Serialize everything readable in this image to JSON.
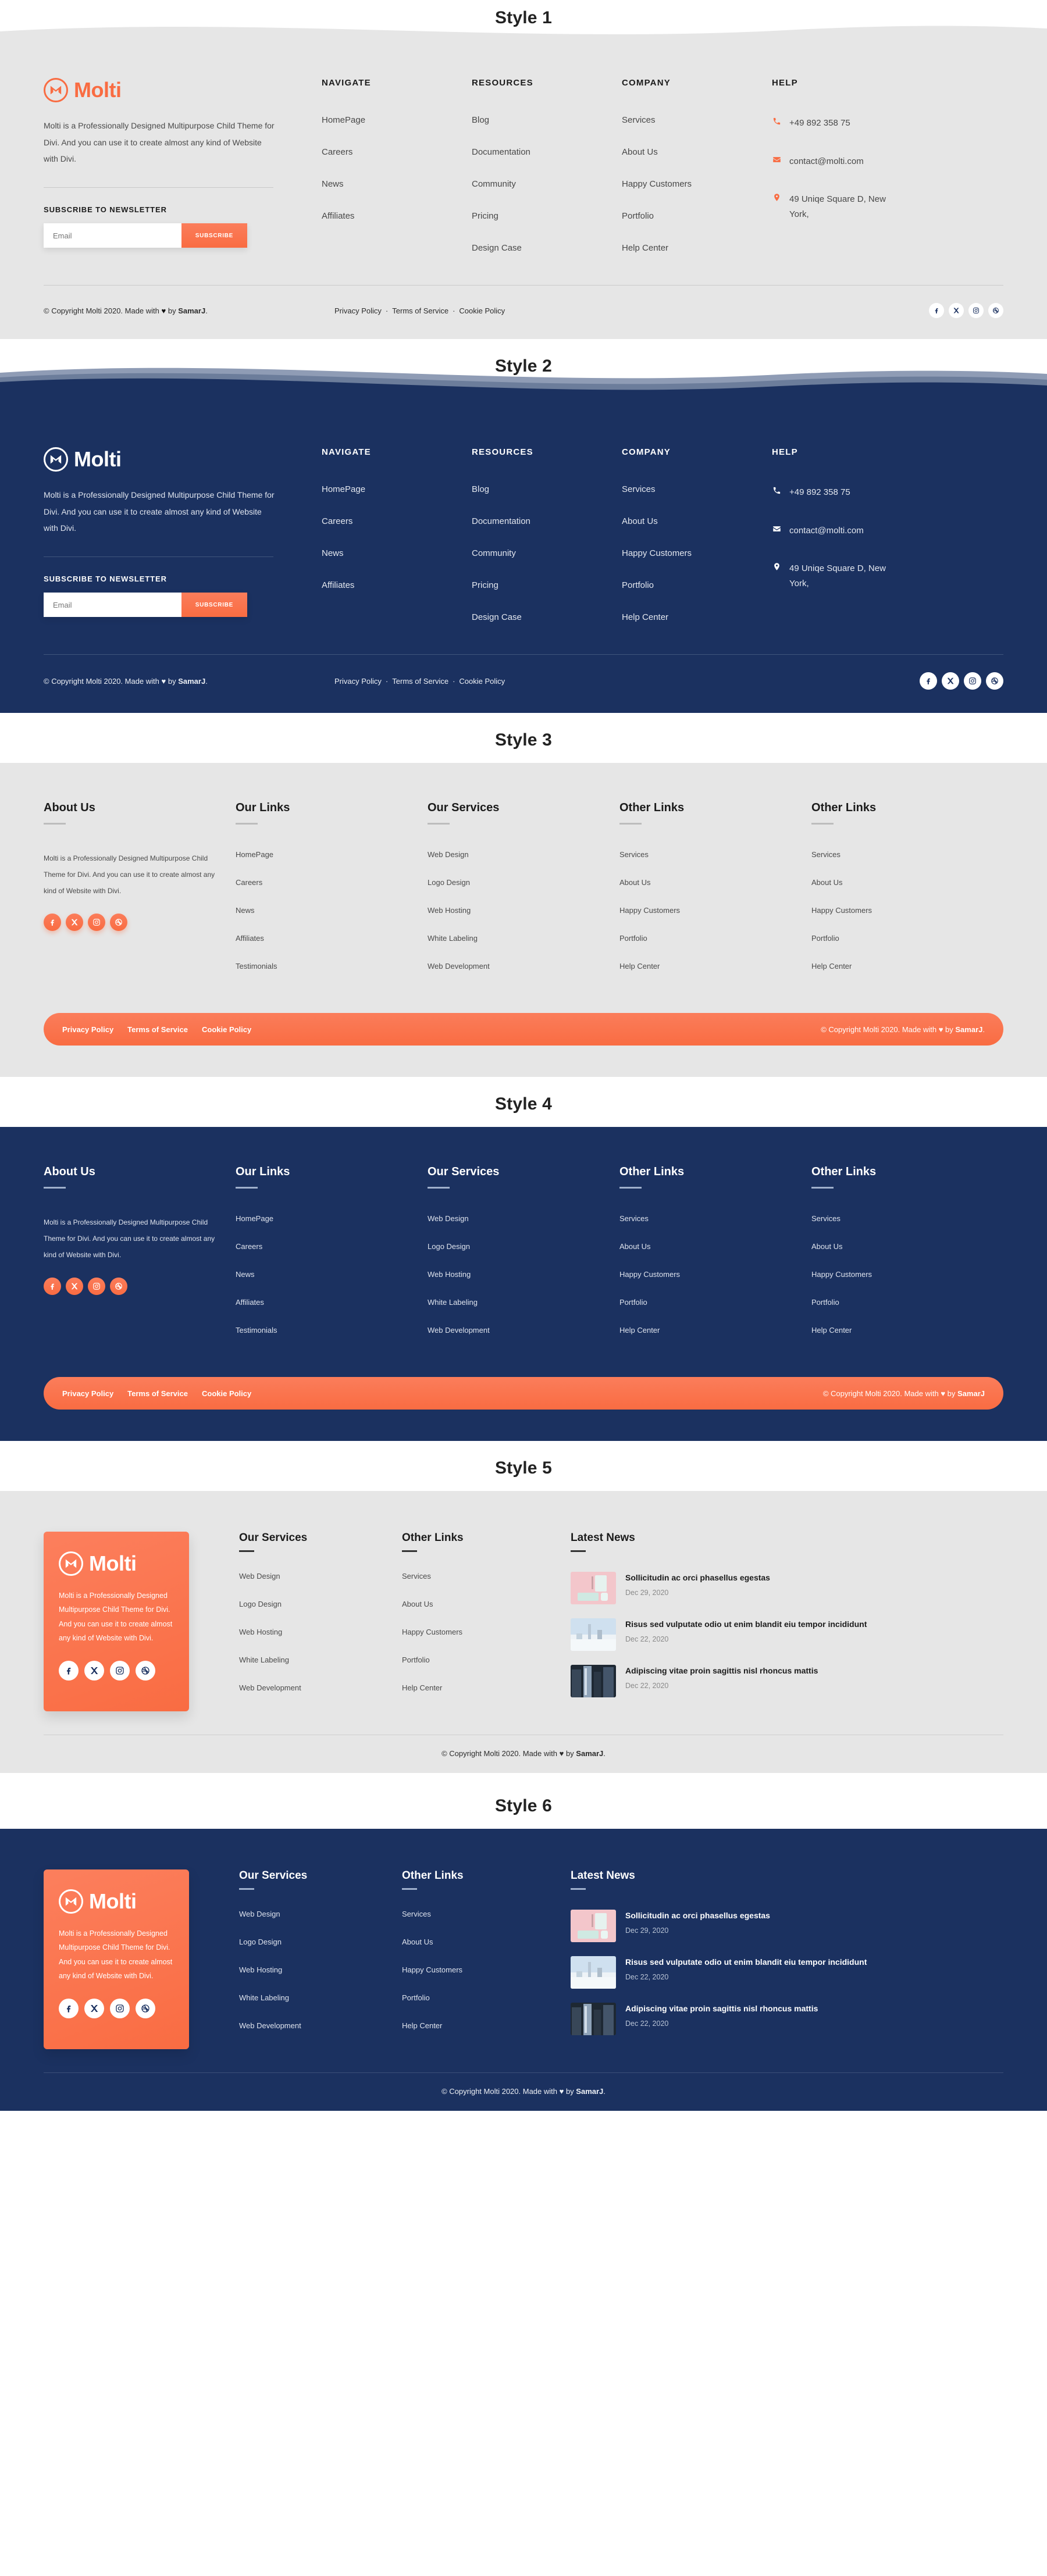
{
  "brand": {
    "name": "Molti",
    "colors": {
      "orange": "#F96C42",
      "navy": "#1B3160",
      "light_gray_bg": "#E6E6E6",
      "white": "#FFFFFF"
    }
  },
  "section_titles": {
    "s1": "Style 1",
    "s2": "Style 2",
    "s3": "Style 3",
    "s4": "Style 4",
    "s5": "Style 5",
    "s6": "Style 6"
  },
  "about": {
    "paragraph_wide": "Molti is a Professionally Designed  Multipurpose Child Theme for Divi. And you can use it to create almost any kind of Website with Divi.",
    "paragraph_narrow": "Molti is a Professionally Designed Multipurpose Child Theme for Divi. And you can use it to create almost any kind of Website with Divi.",
    "paragraph_card": "Molti is a Professionally Designed Multipurpose Child Theme for Divi. And you can use it to create almost any kind of Website with Divi."
  },
  "newsletter": {
    "title": "SUBSCRIBE TO NEWSLETTER",
    "placeholder": "Email",
    "button": "SUBSCRIBE"
  },
  "columns_a": [
    {
      "head": "NAVIGATE",
      "links": [
        "HomePage",
        "Careers",
        "News",
        "Affiliates"
      ]
    },
    {
      "head": "RESOURCES",
      "links": [
        "Blog",
        "Documentation",
        "Community",
        "Pricing",
        "Design Case"
      ]
    },
    {
      "head": "COMPANY",
      "links": [
        "Services",
        "About Us",
        "Happy Customers",
        "Portfolio",
        "Help Center"
      ]
    }
  ],
  "help": {
    "head": "HELP",
    "phone": "+49 892 358 75",
    "email": "contact@molti.com",
    "address": "49 Uniqe Square D, New York,"
  },
  "columns_b": [
    {
      "head": "About Us",
      "links": []
    },
    {
      "head": "Our Links",
      "links": [
        "HomePage",
        "Careers",
        "News",
        "Affiliates",
        "Testimonials"
      ]
    },
    {
      "head": "Our Services",
      "links": [
        "Web Design",
        "Logo Design",
        "Web Hosting",
        "White Labeling",
        "Web Development"
      ]
    },
    {
      "head": "Other Links",
      "links": [
        "Services",
        "About Us",
        "Happy Customers",
        "Portfolio",
        "Help Center"
      ]
    },
    {
      "head": "Other Links",
      "links": [
        "Services",
        "About Us",
        "Happy Customers",
        "Portfolio",
        "Help Center"
      ]
    }
  ],
  "columns_c": [
    {
      "head": "Our Services",
      "links": [
        "Web Design",
        "Logo Design",
        "Web Hosting",
        "White Labeling",
        "Web Development"
      ]
    },
    {
      "head": "Other Links",
      "links": [
        "Services",
        "About Us",
        "Happy Customers",
        "Portfolio",
        "Help Center"
      ]
    }
  ],
  "news": {
    "head": "Latest News",
    "items": [
      {
        "title": "Sollicitudin ac orci phasellus egestas",
        "date": "Dec 29, 2020",
        "thumb": "pink-desk-photo"
      },
      {
        "title": "Risus sed vulputate odio ut enim blandit eiu tempor incididunt",
        "date": "Dec 22, 2020",
        "thumb": "foggy-city-photo"
      },
      {
        "title": "Adipiscing vitae proin sagittis nisl rhoncus mattis",
        "date": "Dec 22, 2020",
        "thumb": "skyscraper-photo"
      }
    ]
  },
  "bottom": {
    "copyright_prefix": "© Copyright Molti 2020. Made with ",
    "copyright_heart": "♥",
    "copyright_mid": " by ",
    "copyright_author": "SamarJ",
    "copyright_suffix": ".",
    "legal": [
      "Privacy Policy",
      "·",
      "Terms of Service",
      "·",
      "Cookie Policy"
    ],
    "legal_plain": [
      "Privacy Policy",
      "Terms of Service",
      "Cookie Policy"
    ]
  },
  "socials": [
    {
      "name": "facebook-icon",
      "label": "Facebook"
    },
    {
      "name": "x-twitter-icon",
      "label": "X"
    },
    {
      "name": "instagram-icon",
      "label": "Instagram"
    },
    {
      "name": "dribbble-icon",
      "label": "Dribbble"
    }
  ]
}
